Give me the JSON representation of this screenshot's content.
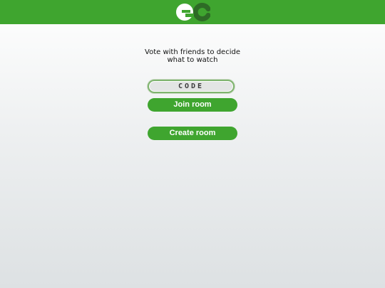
{
  "header": {
    "logo_icon": "ec-logo-icon",
    "brand_color": "#3fa52f"
  },
  "main": {
    "tagline": "Vote with friends to decide\nwhat to watch",
    "code_input": {
      "value": "",
      "placeholder": "CODE"
    },
    "join_label": "Join room",
    "create_label": "Create room"
  }
}
